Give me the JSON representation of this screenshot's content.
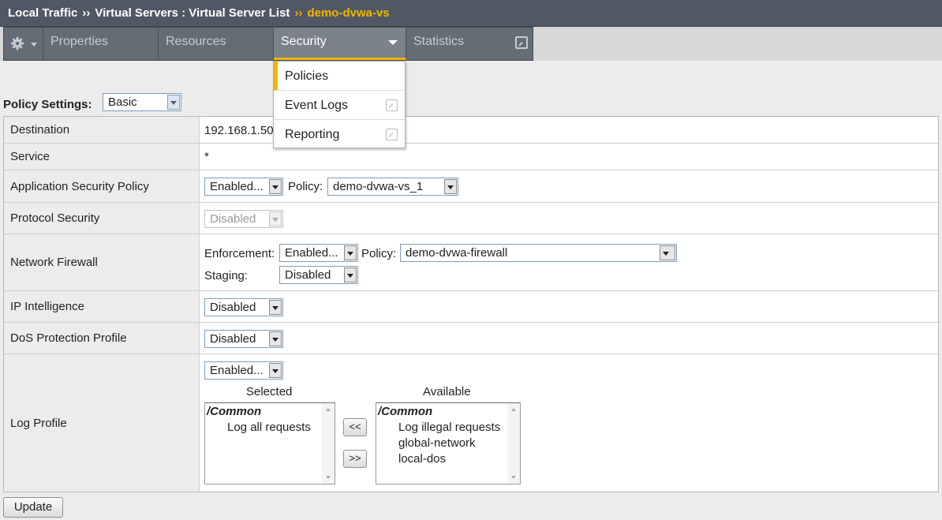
{
  "breadcrumb": {
    "items": [
      "Local Traffic",
      "Virtual Servers : Virtual Server List"
    ],
    "separator": "››",
    "current": "demo-dvwa-vs"
  },
  "tabs": {
    "properties": "Properties",
    "resources": "Resources",
    "security": "Security",
    "statistics": "Statistics"
  },
  "security_menu": {
    "items": [
      {
        "label": "Policies",
        "active": true
      },
      {
        "label": "Event Logs",
        "external": true
      },
      {
        "label": "Reporting",
        "external": true
      }
    ]
  },
  "policy_settings": {
    "label": "Policy Settings:",
    "value": "Basic"
  },
  "rows": {
    "destination": {
      "label": "Destination",
      "value": "192.168.1.50"
    },
    "service": {
      "label": "Service",
      "value": "*"
    },
    "asp": {
      "label": "Application Security Policy",
      "state": "Enabled...",
      "policy_label": "Policy:",
      "policy": "demo-dvwa-vs_1"
    },
    "protocol_security": {
      "label": "Protocol Security",
      "state": "Disabled"
    },
    "network_firewall": {
      "label": "Network Firewall",
      "enforcement_label": "Enforcement:",
      "enforcement": "Enabled...",
      "policy_label": "Policy:",
      "policy": "demo-dvwa-firewall",
      "staging_label": "Staging:",
      "staging": "Disabled"
    },
    "ip_intelligence": {
      "label": "IP Intelligence",
      "state": "Disabled"
    },
    "dos_profile": {
      "label": "DoS Protection Profile",
      "state": "Disabled"
    },
    "log_profile": {
      "label": "Log Profile",
      "state": "Enabled...",
      "selected_header": "Selected",
      "available_header": "Available",
      "selected_group": "/Common",
      "selected_items": [
        "Log all requests"
      ],
      "available_group": "/Common",
      "available_items": [
        "Log illegal requests",
        "global-network",
        "local-dos"
      ],
      "move_left": "<<",
      "move_right": ">>"
    }
  },
  "update_button": "Update",
  "colors": {
    "accent": "#f4b400",
    "titlebar": "#505963",
    "tabstrip": "#646c76"
  }
}
